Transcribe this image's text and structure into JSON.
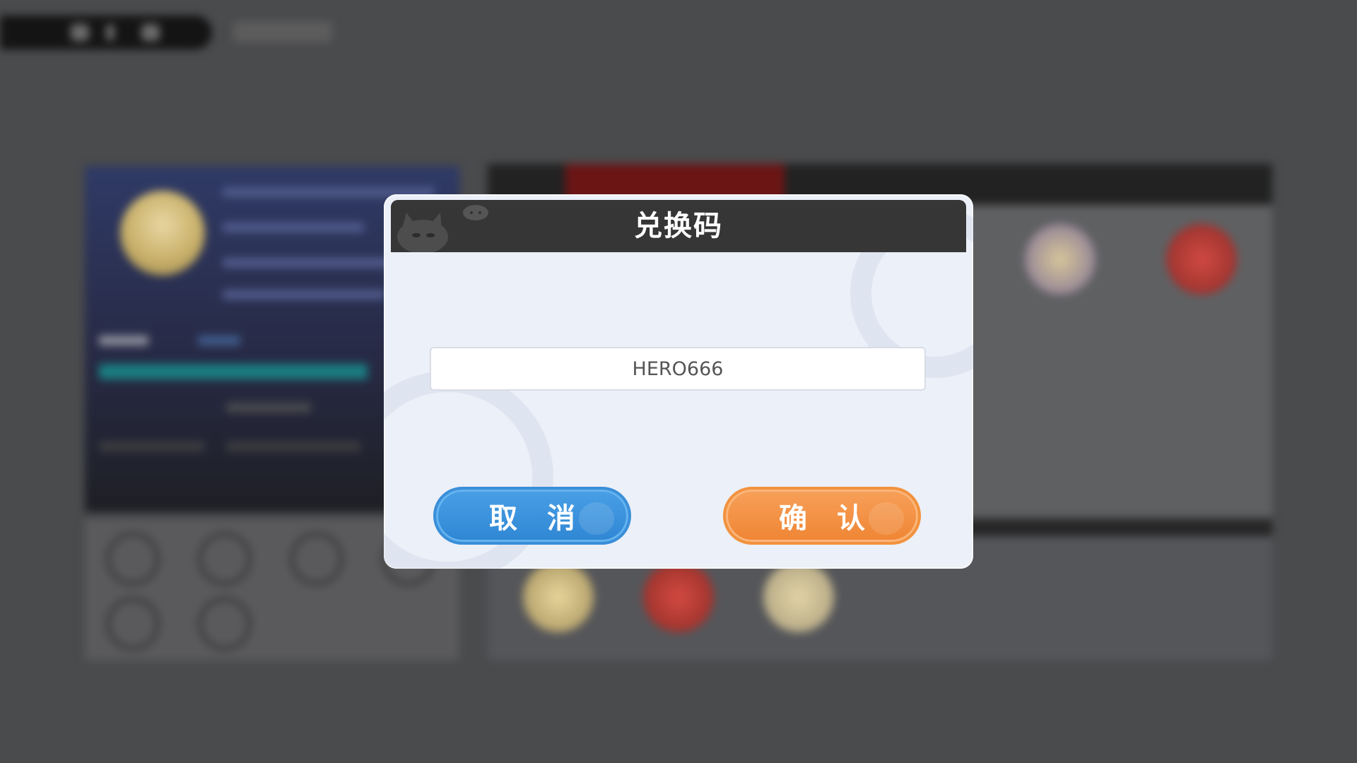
{
  "dialog": {
    "title": "兑换码",
    "input_value": "HERO666",
    "cancel_label": "取 消",
    "confirm_label": "确 认"
  },
  "colors": {
    "overlay_bg": "#4a4b4d",
    "dialog_bg": "#ecf0f8",
    "header_bg": "#363636",
    "cancel_button": "#3a8fd9",
    "confirm_button": "#f2923e"
  },
  "icons": {
    "header_mascot": "mascot-icon",
    "cancel_deco": "paw-icon",
    "confirm_deco": "paw-icon"
  }
}
